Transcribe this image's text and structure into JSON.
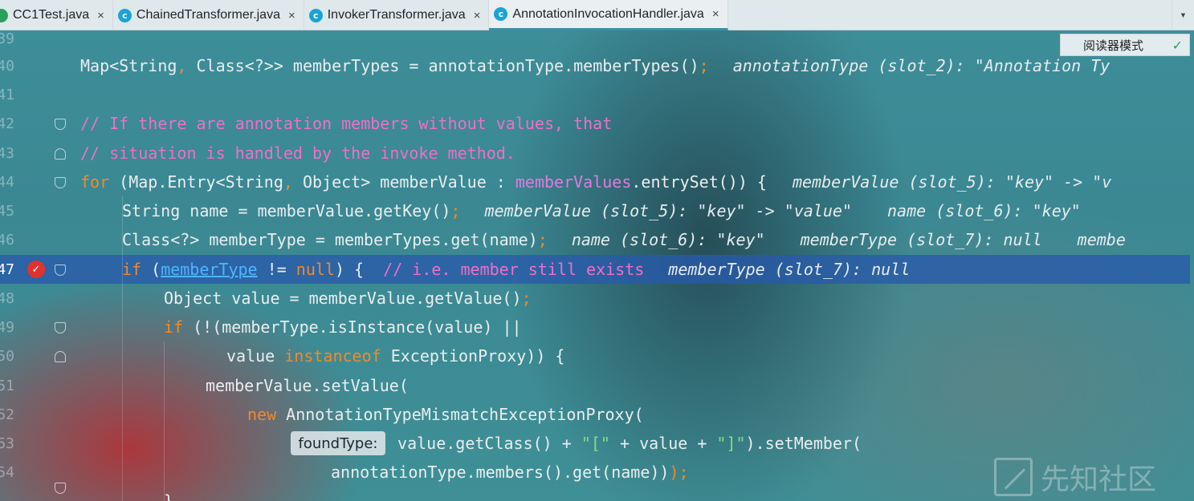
{
  "tabs": [
    {
      "label": "CC1Test.java",
      "icon": "java-run-icon",
      "active": false
    },
    {
      "label": "ChainedTransformer.java",
      "icon": "java-class-icon",
      "active": false
    },
    {
      "label": "InvokerTransformer.java",
      "icon": "java-class-icon",
      "active": false
    },
    {
      "label": "AnnotationInvocationHandler.java",
      "icon": "java-class-icon",
      "active": true
    }
  ],
  "tab_close_glyph": "×",
  "reader_mode": {
    "label": "阅读器模式"
  },
  "line_numbers": [
    "39",
    "40",
    "41",
    "42",
    "43",
    "44",
    "45",
    "46",
    "47",
    "48",
    "49",
    "50",
    "51",
    "52",
    "53",
    "54"
  ],
  "code": {
    "l40": {
      "a": "Map<String",
      "b": ", ",
      "c": "Class<?>> memberTypes = annotationType.memberTypes()",
      "d": ";",
      "inline": "annotationType (slot_2): \"Annotation Ty"
    },
    "l42": {
      "comment": "// If there are annotation members without values, that"
    },
    "l43": {
      "comment": "// situation is handled by the invoke method."
    },
    "l44": {
      "kw": "for",
      "a": " (Map.Entry<String",
      "b": ", ",
      "c": "Object> memberValue : ",
      "field": "memberValues",
      "d": ".entrySet()) {",
      "inline": "memberValue (slot_5): \"key\" -> \"v"
    },
    "l45": {
      "a": "String name = memberValue.getKey()",
      "b": ";",
      "inline1": "memberValue (slot_5): \"key\" -> \"value\"",
      "inline2": "name (slot_6): \"key\""
    },
    "l46": {
      "a": "Class<?> memberType = memberTypes.get(name)",
      "b": ";",
      "inline1": "name (slot_6): \"key\"",
      "inline2": "memberType (slot_7): null",
      "inline3": "membe"
    },
    "l47": {
      "kw": "if",
      "a": " (",
      "link": "memberType",
      "b": " != ",
      "kw2": "null",
      "c": ") {  ",
      "comment": "// i.e. member still exists",
      "inline": "memberType (slot_7): null"
    },
    "l48": {
      "a": "Object value = memberValue.getValue()",
      "b": ";"
    },
    "l49": {
      "kw": "if",
      "a": " (!(memberType.isInstance(value) ||"
    },
    "l50": {
      "a": "value ",
      "kw": "instanceof",
      "b": " ExceptionProxy)) {"
    },
    "l51": {
      "a": "memberValue.setValue("
    },
    "l52": {
      "kw": "new",
      "a": " AnnotationTypeMismatchExceptionProxy("
    },
    "l53": {
      "hint": "foundType:",
      "a": " value.getClass() + ",
      "s1": "\"[\"",
      "b": " + value + ",
      "s2": "\"]\"",
      "c": ").setMember("
    },
    "l54": {
      "a": "annotationType.members().get(name))",
      "b": ");"
    },
    "l55": {
      "a": "}"
    }
  },
  "watermark": {
    "text": "先知社区"
  },
  "colors": {
    "accent": "#3d8fa3",
    "breakpoint": "#e0322f",
    "current_line": "#285aaa",
    "keyword": "#f08a2c",
    "comment": "#ef6fc9"
  }
}
